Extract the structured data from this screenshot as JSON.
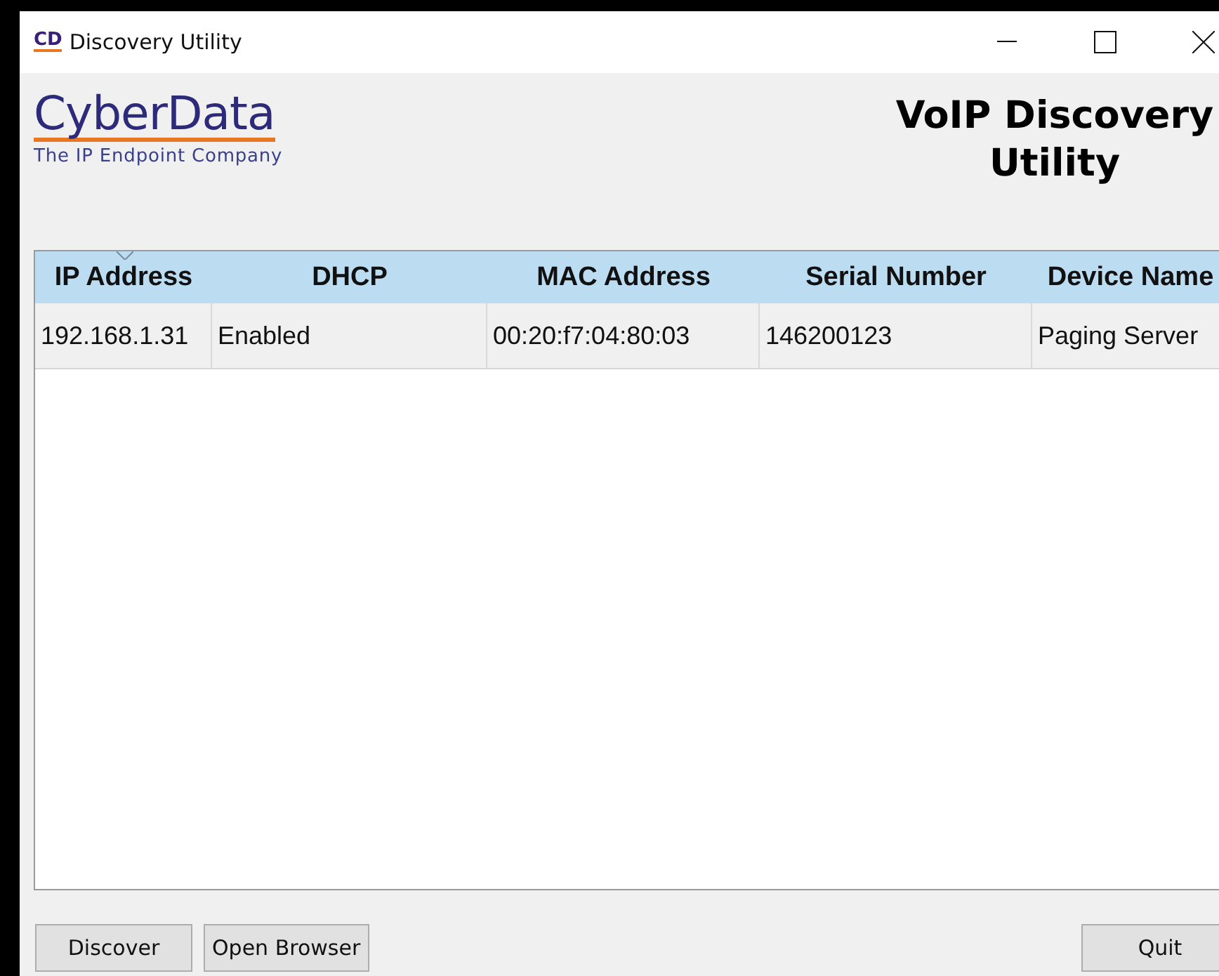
{
  "window": {
    "icon_text": "CD",
    "title": "Discovery Utility"
  },
  "header": {
    "logo": "CyberData",
    "tagline": "The IP Endpoint Company",
    "heading": "VoIP Discovery Utility"
  },
  "table": {
    "columns": [
      {
        "label": "IP Address",
        "sorted": true
      },
      {
        "label": "DHCP",
        "sorted": false
      },
      {
        "label": "MAC Address",
        "sorted": false
      },
      {
        "label": "Serial Number",
        "sorted": false
      },
      {
        "label": "Device Name",
        "sorted": false
      }
    ],
    "rows": [
      {
        "cells": [
          "192.168.1.31",
          "Enabled",
          "00:20:f7:04:80:03",
          "146200123",
          "Paging Server"
        ],
        "selected": false
      }
    ]
  },
  "left_buttons": [
    "Discover",
    "Open Browser"
  ],
  "right_buttons": [
    "Quit"
  ]
}
